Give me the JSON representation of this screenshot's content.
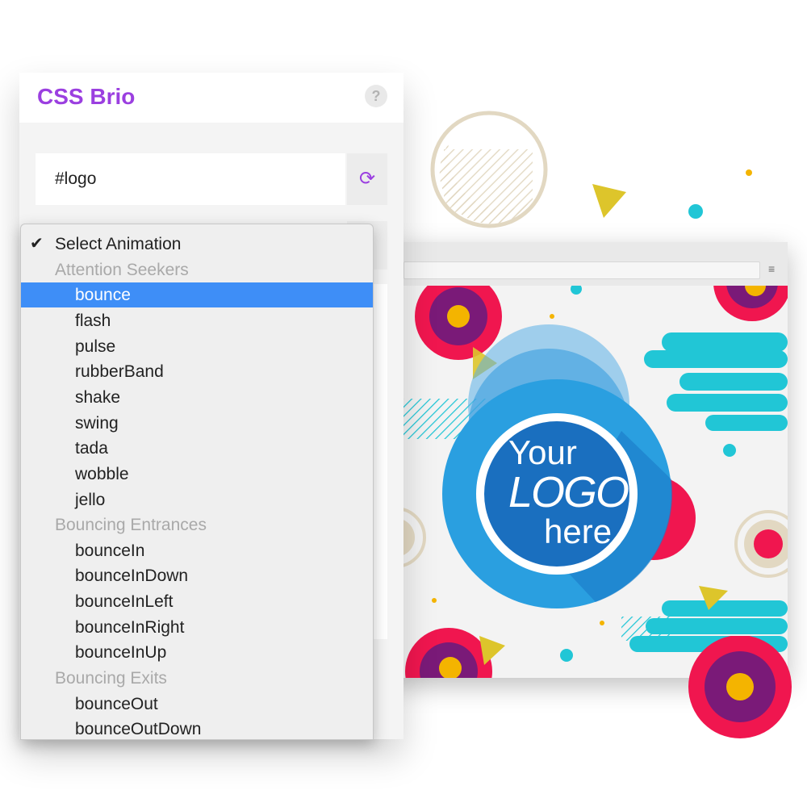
{
  "app": {
    "title": "CSS Brio",
    "help_label": "?"
  },
  "selector": {
    "value": "#logo",
    "refresh_icon": "refresh-icon"
  },
  "animation_select": {
    "selected_label": "Select Animation",
    "groups": [
      {
        "label": "Attention Seekers",
        "options": [
          "bounce",
          "flash",
          "pulse",
          "rubberBand",
          "shake",
          "swing",
          "tada",
          "wobble",
          "jello"
        ]
      },
      {
        "label": "Bouncing Entrances",
        "options": [
          "bounceIn",
          "bounceInDown",
          "bounceInLeft",
          "bounceInRight",
          "bounceInUp"
        ]
      },
      {
        "label": "Bouncing Exits",
        "options": [
          "bounceOut",
          "bounceOutDown"
        ]
      }
    ],
    "highlighted": "bounce"
  },
  "preview": {
    "logo_lines": [
      "Your",
      "LOGO",
      "here"
    ],
    "menu_icon": "hamburger-icon"
  },
  "colors": {
    "accent": "#9b3fe0",
    "highlight": "#3e8ef7",
    "logo_blue": "#1a6fbf",
    "cyan": "#21c6d6",
    "red": "#f0164f",
    "purple": "#7a1a78",
    "yellow": "#f4b400"
  }
}
